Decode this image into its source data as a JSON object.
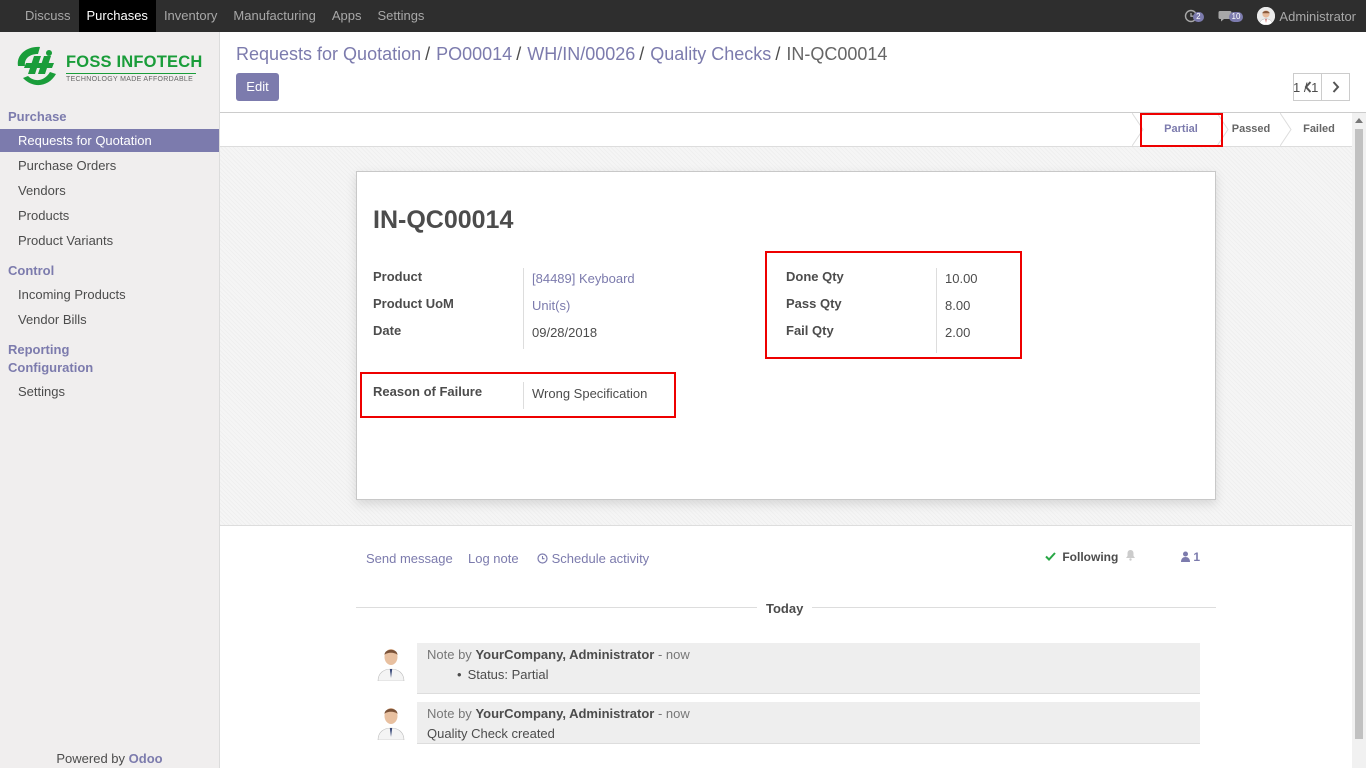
{
  "topbar": {
    "menu": [
      "Discuss",
      "Purchases",
      "Inventory",
      "Manufacturing",
      "Apps",
      "Settings"
    ],
    "active_menu": "Purchases",
    "activity_count": "2",
    "messages_count": "10",
    "user_name": "Administrator"
  },
  "sidebar": {
    "logo_title": "FOSS INFOTECH",
    "logo_tagline": "TECHNOLOGY MADE AFFORDABLE",
    "purchase_title": "Purchase",
    "purchase_items": [
      "Requests for Quotation",
      "Purchase Orders",
      "Vendors",
      "Products",
      "Product Variants"
    ],
    "control_title": "Control",
    "control_items": [
      "Incoming Products",
      "Vendor Bills"
    ],
    "reporting_title": "Reporting",
    "configuration_title": "Configuration",
    "config_items": [
      "Settings"
    ],
    "powered_prefix": "Powered by",
    "powered_brand": "Odoo"
  },
  "breadcrumb": {
    "items": [
      "Requests for Quotation",
      "PO00014",
      "WH/IN/00026",
      "Quality Checks"
    ],
    "current": "IN-QC00014",
    "separator": "/"
  },
  "toolbar": {
    "edit_label": "Edit"
  },
  "pager": {
    "value": "1 / 1"
  },
  "status": {
    "stages": [
      "Partial",
      "Passed",
      "Failed"
    ],
    "current": "Partial"
  },
  "record": {
    "title": "IN-QC00014",
    "product_label": "Product",
    "product_value": "[84489] Keyboard",
    "uom_label": "Product UoM",
    "uom_value": "Unit(s)",
    "date_label": "Date",
    "date_value": "09/28/2018",
    "done_label": "Done Qty",
    "done_value": "10.00",
    "pass_label": "Pass Qty",
    "pass_value": "8.00",
    "fail_label": "Fail Qty",
    "fail_value": "2.00",
    "reason_label": "Reason of Failure",
    "reason_value": "Wrong Specification"
  },
  "chatter": {
    "send_message": "Send message",
    "log_note": "Log note",
    "schedule_activity": "Schedule activity",
    "following": "Following",
    "followers": "1",
    "day_label": "Today",
    "messages": [
      {
        "prefix": "Note by",
        "author": "YourCompany, Administrator",
        "time": "- now",
        "body": "Status: Partial"
      },
      {
        "prefix": "Note by",
        "author": "YourCompany, Administrator",
        "time": "- now",
        "body": "Quality Check created"
      }
    ]
  }
}
